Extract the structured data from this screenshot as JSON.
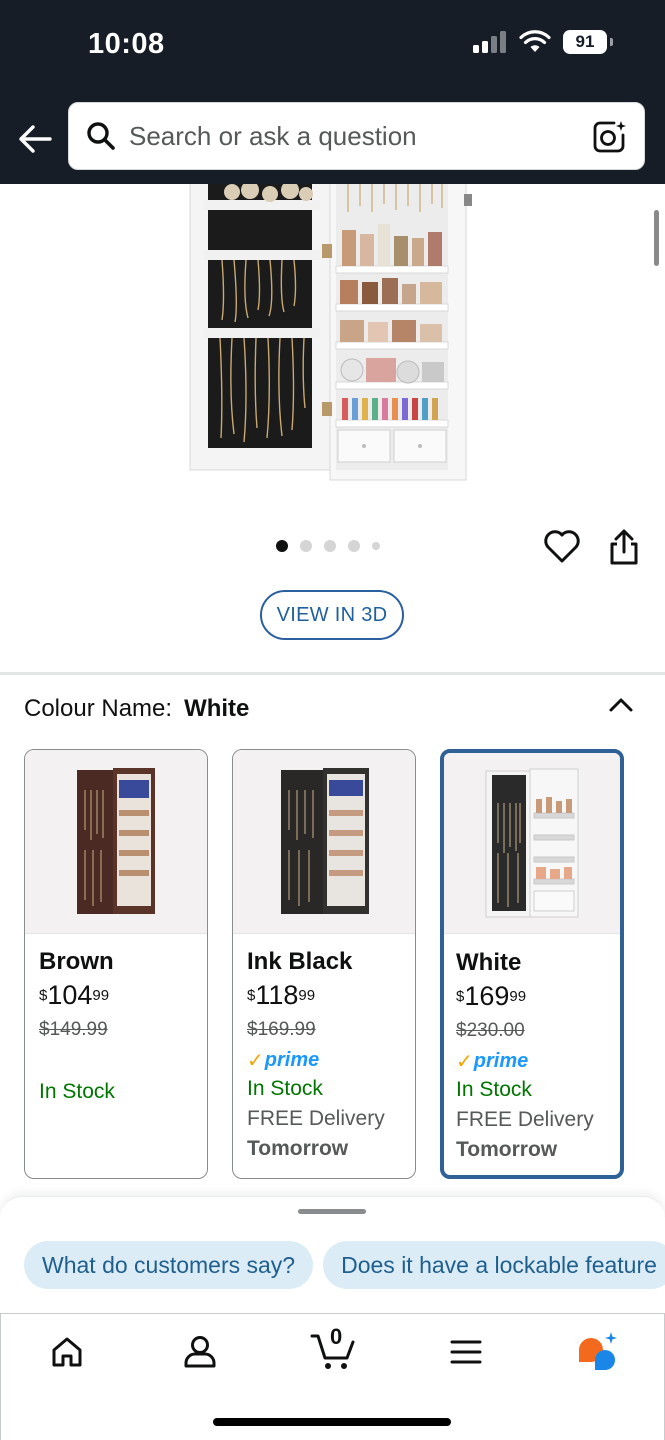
{
  "status_bar": {
    "time": "10:08",
    "battery": "91"
  },
  "search": {
    "placeholder": "Search or ask a question"
  },
  "product_image": {
    "dots_count": 5,
    "active_dot": 1
  },
  "view_in_3d_label": "VIEW IN 3D",
  "colour": {
    "label": "Colour Name:",
    "selected": "White"
  },
  "variants": [
    {
      "name": "Brown",
      "currency": "$",
      "price_whole": "104",
      "price_fraction": "99",
      "was_price": "$149.99",
      "prime": false,
      "stock": "In Stock",
      "delivery": "",
      "delivery_day": "",
      "swatch_color": "#4a2a22",
      "selected": false
    },
    {
      "name": "Ink Black",
      "currency": "$",
      "price_whole": "118",
      "price_fraction": "99",
      "was_price": "$169.99",
      "prime": true,
      "prime_label": "prime",
      "stock": "In Stock",
      "delivery": "FREE Delivery",
      "delivery_day": "Tomorrow",
      "swatch_color": "#2a2727",
      "selected": false
    },
    {
      "name": "White",
      "currency": "$",
      "price_whole": "169",
      "price_fraction": "99",
      "was_price": "$230.00",
      "prime": true,
      "prime_label": "prime",
      "stock": "In Stock",
      "delivery": "FREE Delivery",
      "delivery_day": "Tomorrow",
      "swatch_color": "#f4f4f4",
      "selected": true
    }
  ],
  "suggestions": [
    "What do customers say?",
    "Does it have a lockable feature"
  ],
  "nav": {
    "cart_count": "0",
    "items": [
      "home-icon",
      "account-icon",
      "cart-icon",
      "menu-icon",
      "rufus-ai-icon"
    ]
  },
  "colors": {
    "header_bg": "#161d26",
    "accent_blue": "#2f6196",
    "in_stock_green": "#007600",
    "prime_blue": "#1a98ff",
    "chip_bg": "#dcecf6"
  }
}
